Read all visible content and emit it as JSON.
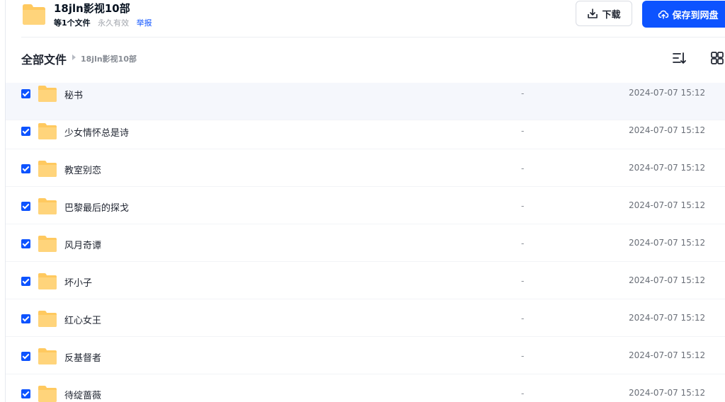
{
  "share": {
    "title": "18jln影视10部",
    "file_count": "等1个文件",
    "validity": "永久有效",
    "report_label": "举报",
    "folder_icon": "folder-icon"
  },
  "actions": {
    "download_label": "下载",
    "download_icon": "download-icon",
    "save_label": "保存到网盘",
    "save_icon": "cloud-upload-icon"
  },
  "breadcrumb": {
    "root": "全部文件",
    "current": "18jln影视10部"
  },
  "toolbar": {
    "sort_icon": "sort-icon",
    "view_icon": "grid-view-icon"
  },
  "colors": {
    "accent": "#0d53ff",
    "folder": "#ffc95f",
    "selected_row": "#f5f7fc"
  },
  "files": [
    {
      "name": "秘书",
      "size": "-",
      "time": "2024-07-07 15:12",
      "checked": true
    },
    {
      "name": "少女情怀总是诗",
      "size": "-",
      "time": "2024-07-07 15:12",
      "checked": true
    },
    {
      "name": "教室别恋",
      "size": "-",
      "time": "2024-07-07 15:12",
      "checked": true
    },
    {
      "name": "巴黎最后的探戈",
      "size": "-",
      "time": "2024-07-07 15:12",
      "checked": true
    },
    {
      "name": "风月奇谭",
      "size": "-",
      "time": "2024-07-07 15:12",
      "checked": true
    },
    {
      "name": "坏小子",
      "size": "-",
      "time": "2024-07-07 15:12",
      "checked": true
    },
    {
      "name": "红心女王",
      "size": "-",
      "time": "2024-07-07 15:12",
      "checked": true
    },
    {
      "name": "反基督者",
      "size": "-",
      "time": "2024-07-07 15:12",
      "checked": true
    },
    {
      "name": "待绽蔷薇",
      "size": "-",
      "time": "2024-07-07 15:12",
      "checked": true
    }
  ]
}
